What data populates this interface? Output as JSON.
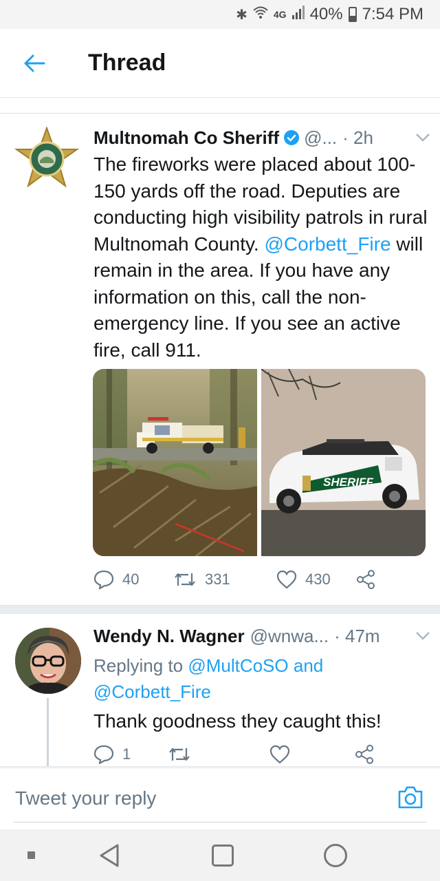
{
  "status_bar": {
    "signal_label": "4G",
    "battery": "40%",
    "time": "7:54 PM"
  },
  "header": {
    "title": "Thread"
  },
  "tweet1": {
    "name": "Multnomah Co Sheriff",
    "handle": "@...",
    "time": "· 2h",
    "body_part1": "The fireworks were placed about 100-150 yards off the road. Deputies are conducting high visibility patrols in rural Multnomah County. ",
    "mention": "@Corbett_Fire",
    "body_part2": " will remain in the area. If you have any information on this, call the non-emergency line. If you see an active fire, call 911.",
    "replies": "40",
    "retweets": "331",
    "likes": "430",
    "vehicle_text": "SHERIFF"
  },
  "tweet2": {
    "name": "Wendy N. Wagner",
    "handle": "@wnwa...",
    "time": "· 47m",
    "replying_label": "Replying to",
    "replying_to_1": "@MultCoSO",
    "replying_and": "and",
    "replying_to_2": "@Corbett_Fire",
    "text": "Thank goodness they caught this!",
    "replies": "1"
  },
  "reply_bar": {
    "placeholder": "Tweet your reply"
  },
  "colors": {
    "accent": "#1da1f2",
    "text": "#14171a",
    "muted": "#657786",
    "divider": "#e6ecf0"
  }
}
